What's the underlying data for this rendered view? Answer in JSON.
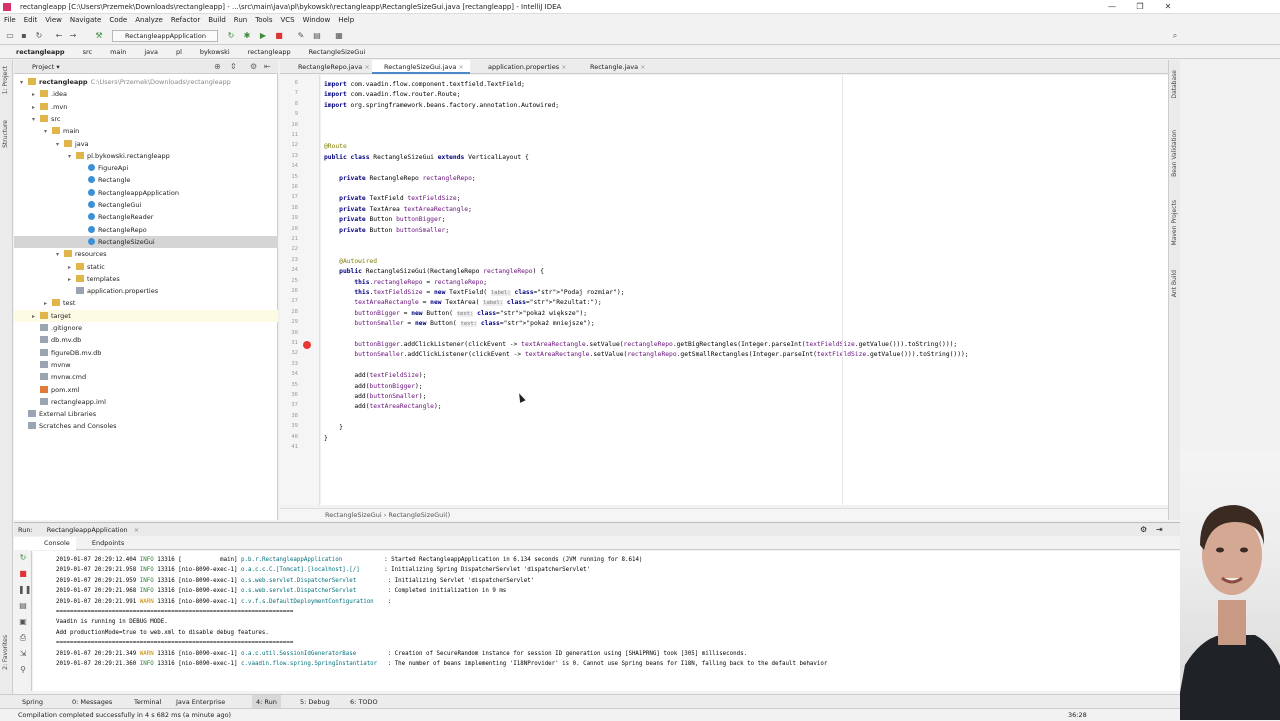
{
  "window": {
    "title": "rectangleapp [C:\\Users\\Przemek\\Downloads\\rectangleapp] - ...\\src\\main\\java\\pl\\bykowski\\rectangleapp\\RectangleSizeGui.java [rectangleapp] - IntelliJ IDEA",
    "minimize": "—",
    "restore": "❐",
    "close": "✕"
  },
  "menu": [
    "File",
    "Edit",
    "View",
    "Navigate",
    "Code",
    "Analyze",
    "Refactor",
    "Build",
    "Run",
    "Tools",
    "VCS",
    "Window",
    "Help"
  ],
  "toolbar": {
    "run_config": "RectangleappApplication"
  },
  "breadcrumbs": [
    "rectangleapp",
    "src",
    "main",
    "java",
    "pl",
    "bykowski",
    "rectangleapp",
    "RectangleSizeGui"
  ],
  "project": {
    "title": "Project",
    "tree": [
      {
        "label": "rectangleapp",
        "extra": "C:\\Users\\Przemek\\Downloads\\rectangleapp",
        "icon": "folder",
        "indent": 0,
        "open": true
      },
      {
        "label": ".idea",
        "icon": "folder",
        "indent": 1
      },
      {
        "label": ".mvn",
        "icon": "folder",
        "indent": 1
      },
      {
        "label": "src",
        "icon": "folder",
        "indent": 1,
        "open": true
      },
      {
        "label": "main",
        "icon": "folder",
        "indent": 2,
        "open": true
      },
      {
        "label": "java",
        "icon": "folder",
        "indent": 3,
        "open": true
      },
      {
        "label": "pl.bykowski.rectangleapp",
        "icon": "folder",
        "indent": 4,
        "open": true
      },
      {
        "label": "FigureApi",
        "icon": "class",
        "indent": 5
      },
      {
        "label": "Rectangle",
        "icon": "class",
        "indent": 5
      },
      {
        "label": "RectangleappApplication",
        "icon": "class",
        "indent": 5
      },
      {
        "label": "RectangleGui",
        "icon": "class",
        "indent": 5
      },
      {
        "label": "RectangleReader",
        "icon": "class",
        "indent": 5
      },
      {
        "label": "RectangleRepo",
        "icon": "class",
        "indent": 5
      },
      {
        "label": "RectangleSizeGui",
        "icon": "class",
        "indent": 5,
        "selected": true
      },
      {
        "label": "resources",
        "icon": "folder",
        "indent": 3,
        "open": true
      },
      {
        "label": "static",
        "icon": "folder",
        "indent": 4
      },
      {
        "label": "templates",
        "icon": "folder",
        "indent": 4
      },
      {
        "label": "application.properties",
        "icon": "file",
        "indent": 4
      },
      {
        "label": "test",
        "icon": "folder",
        "indent": 2
      },
      {
        "label": "target",
        "icon": "folder",
        "indent": 1,
        "highlight": true
      },
      {
        "label": ".gitignore",
        "icon": "file",
        "indent": 1
      },
      {
        "label": "db.mv.db",
        "icon": "file",
        "indent": 1
      },
      {
        "label": "figureDB.mv.db",
        "icon": "file",
        "indent": 1
      },
      {
        "label": "mvnw",
        "icon": "file",
        "indent": 1
      },
      {
        "label": "mvnw.cmd",
        "icon": "file",
        "indent": 1
      },
      {
        "label": "pom.xml",
        "icon": "xml",
        "indent": 1
      },
      {
        "label": "rectangleapp.iml",
        "icon": "file",
        "indent": 1
      },
      {
        "label": "External Libraries",
        "icon": "file",
        "indent": 0
      },
      {
        "label": "Scratches and Consoles",
        "icon": "file",
        "indent": 0
      }
    ]
  },
  "editor_tabs": [
    "RectangleRepo.java",
    "RectangleSizeGui.java",
    "application.properties",
    "Rectangle.java"
  ],
  "active_tab": 1,
  "line_numbers": [
    "6",
    "7",
    "8",
    "9",
    "10",
    "11",
    "12",
    "13",
    "14",
    "15",
    "16",
    "17",
    "18",
    "19",
    "20",
    "21",
    "22",
    "23",
    "24",
    "25",
    "26",
    "27",
    "28",
    "29",
    "30",
    "31",
    "32",
    "33",
    "34",
    "35",
    "36",
    "37",
    "38",
    "39",
    "40",
    "41"
  ],
  "code": [
    "import com.vaadin.flow.component.textfield.TextField;",
    "import com.vaadin.flow.router.Route;",
    "import org.springframework.beans.factory.annotation.Autowired;",
    "",
    "",
    "",
    "@Route",
    "public class RectangleSizeGui extends VerticalLayout {",
    "",
    "    private RectangleRepo rectangleRepo;",
    "",
    "    private TextField textFieldSize;",
    "    private TextArea textAreaRectangle;",
    "    private Button buttonBigger;",
    "    private Button buttonSmaller;",
    "",
    "",
    "    @Autowired",
    "    public RectangleSizeGui(RectangleRepo rectangleRepo) {",
    "        this.rectangleRepo = rectangleRepo;",
    "        this.textFieldSize = new TextField( label: \"Podaj rozmiar\");",
    "        textAreaRectangle = new TextArea( label: \"Rezultat:\");",
    "        buttonBigger = new Button( text: \"pokaż większe\");",
    "        buttonSmaller = new Button( text: \"pokaż mniejsze\");",
    "",
    "        buttonBigger.addClickListener(clickEvent -> textAreaRectangle.setValue(rectangleRepo.getBigRectangles(Integer.parseInt(textFieldSize.getValue())).toString()));",
    "        buttonSmaller.addClickListener(clickEvent -> textAreaRectangle.setValue(rectangleRepo.getSmallRectangles(Integer.parseInt(textFieldSize.getValue())).toString()));",
    "",
    "        add(textFieldSize);",
    "        add(buttonBigger);",
    "        add(buttonSmaller);",
    "        add(textAreaRectangle);",
    "",
    "    }",
    "}",
    ""
  ],
  "editor_breadcrumb": "RectangleSizeGui  ›  RectangleSizeGui()",
  "run": {
    "label": "Run:",
    "config": "RectangleappApplication",
    "tab_console": "Console",
    "tab_endpoints": "Endpoints"
  },
  "console_lines": [
    {
      "ts": "2019-01-07 20:29:12.404",
      "lvl": "INFO",
      "pid": "13316",
      "thr": "[           main]",
      "cls": "p.b.r.RectangleappApplication           ",
      "msg": ": Started RectangleappApplication in 6.134 seconds (JVM running for 8.614)"
    },
    {
      "ts": "2019-01-07 20:29:21.958",
      "lvl": "INFO",
      "pid": "13316",
      "thr": "[nio-8090-exec-1]",
      "cls": "o.a.c.c.C.[Tomcat].[localhost].[/]      ",
      "msg": ": Initializing Spring DispatcherServlet 'dispatcherServlet'"
    },
    {
      "ts": "2019-01-07 20:29:21.959",
      "lvl": "INFO",
      "pid": "13316",
      "thr": "[nio-8090-exec-1]",
      "cls": "o.s.web.servlet.DispatcherServlet        ",
      "msg": ": Initializing Servlet 'dispatcherServlet'"
    },
    {
      "ts": "2019-01-07 20:29:21.968",
      "lvl": "INFO",
      "pid": "13316",
      "thr": "[nio-8090-exec-1]",
      "cls": "o.s.web.servlet.DispatcherServlet        ",
      "msg": ": Completed initialization in 9 ms"
    },
    {
      "ts": "2019-01-07 20:29:21.991",
      "lvl": "WARN",
      "pid": "13316",
      "thr": "[nio-8090-exec-1]",
      "cls": "c.v.f.s.DefaultDeploymentConfiguration   ",
      "msg": ":"
    },
    {
      "plain": "===================================================================="
    },
    {
      "plain": "Vaadin is running in DEBUG MODE."
    },
    {
      "plain": "Add productionMode=true to web.xml to disable debug features."
    },
    {
      "plain": "===================================================================="
    },
    {
      "ts": "2019-01-07 20:29:21.349",
      "lvl": "WARN",
      "pid": "13316",
      "thr": "[nio-8090-exec-1]",
      "cls": "o.a.c.util.SessionIdGeneratorBase        ",
      "msg": ": Creation of SecureRandom instance for session ID generation using [SHA1PRNG] took [305] milliseconds."
    },
    {
      "ts": "2019-01-07 20:29:21.360",
      "lvl": "INFO",
      "pid": "13316",
      "thr": "[nio-8090-exec-1]",
      "cls": "c.vaadin.flow.spring.SpringInstantiator  ",
      "msg": ": The number of beans implementing 'I18NProvider' is 0. Cannot use Spring beans for I18N, falling back to the default behavior"
    }
  ],
  "bottom_tabs": [
    "Spring",
    "0: Messages",
    "Terminal",
    "Java Enterprise",
    "4: Run",
    "5: Debug",
    "6: TODO"
  ],
  "status": {
    "message": "Compilation completed successfully in 4 s 682 ms (a minute ago)",
    "position": "36:28"
  },
  "colors": {
    "accent": "#4a88c7",
    "breakpoint": "#e53935",
    "selection": "#d5d5d5"
  }
}
